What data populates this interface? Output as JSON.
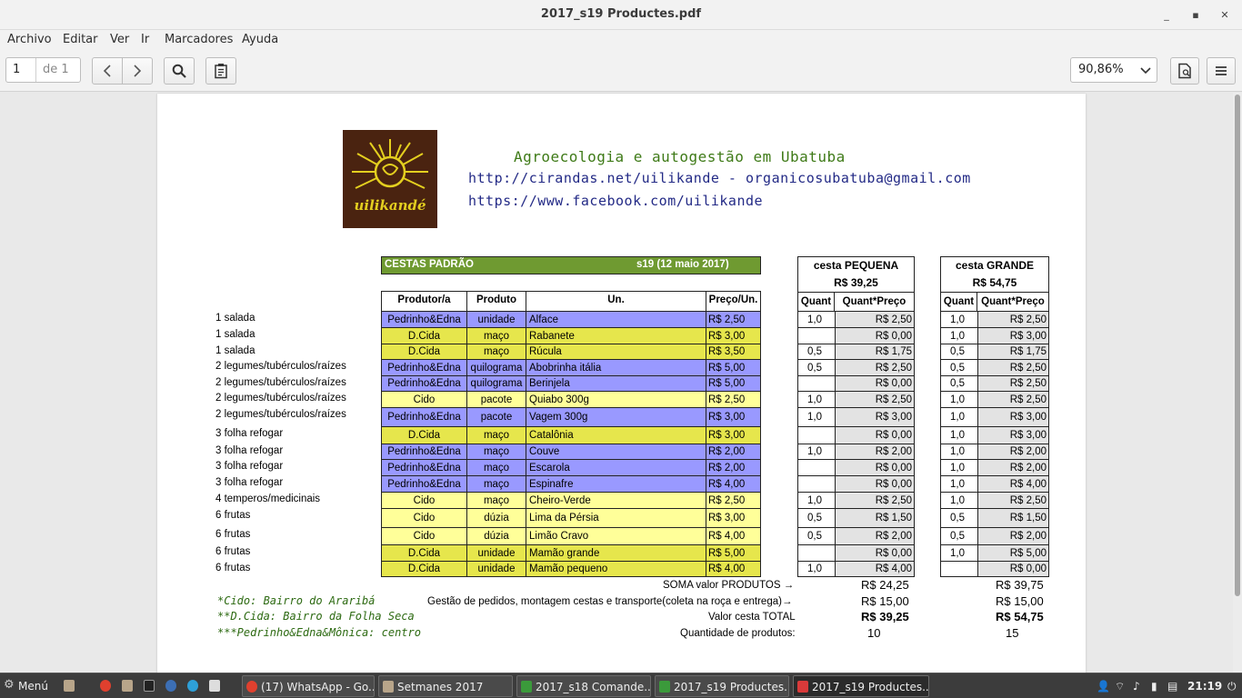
{
  "window": {
    "title": "2017_s19 Productes.pdf"
  },
  "menu": [
    "Archivo",
    "Editar",
    "Ver",
    "Ir",
    "Marcadores",
    "Ayuda"
  ],
  "toolbar": {
    "page_current": "1",
    "page_total": "de 1",
    "zoom": "90,86%"
  },
  "header": {
    "line1": "Agroecologia e autogestão em Ubatuba",
    "line2": "http://cirandas.net/uilikande  -   organicosubatuba@gmail.com",
    "line3": "https://www.facebook.com/uilikande",
    "logo_text": "uilikandé"
  },
  "table": {
    "title": "CESTAS PADRÃO",
    "week": "s19 (12 maio 2017)",
    "columns": [
      "Produtor/a",
      "Produto",
      "Un.",
      "Preço/Un."
    ],
    "small": {
      "title": "cesta PEQUENA",
      "price": "R$ 39,25",
      "cols": [
        "Quant",
        "Quant*Preço"
      ]
    },
    "large": {
      "title": "cesta GRANDE",
      "price": "R$ 54,75",
      "cols": [
        "Quant",
        "Quant*Preço"
      ]
    },
    "rows": [
      {
        "cat": "1 salada",
        "prod": "Pedrinho&Edna",
        "unit": "unidade",
        "item": "Alface",
        "price": "R$ 2,50",
        "q1": "1,0",
        "t1": "R$ 2,50",
        "q2": "1,0",
        "t2": "R$ 2,50",
        "color": "#9999ff"
      },
      {
        "cat": "1 salada",
        "prod": "D.Cida",
        "unit": "maço",
        "item": "Rabanete",
        "price": "R$ 3,00",
        "q1": "",
        "t1": "R$ 0,00",
        "q2": "1,0",
        "t2": "R$ 3,00",
        "color": "#e6e64c"
      },
      {
        "cat": "1 salada",
        "prod": "D.Cida",
        "unit": "maço",
        "item": "Rúcula",
        "price": "R$ 3,50",
        "q1": "0,5",
        "t1": "R$ 1,75",
        "q2": "0,5",
        "t2": "R$ 1,75",
        "color": "#e6e64c"
      },
      {
        "cat": "2 legumes/tubérculos/raízes",
        "prod": "Pedrinho&Edna",
        "unit": "quilograma",
        "item": "Abobrinha itália",
        "price": "R$ 5,00",
        "q1": "0,5",
        "t1": "R$ 2,50",
        "q2": "0,5",
        "t2": "R$ 2,50",
        "color": "#9999ff"
      },
      {
        "cat": "2 legumes/tubérculos/raízes",
        "prod": "Pedrinho&Edna",
        "unit": "quilograma",
        "item": "Berinjela",
        "price": "R$ 5,00",
        "q1": "",
        "t1": "R$ 0,00",
        "q2": "0,5",
        "t2": "R$ 2,50",
        "color": "#9999ff"
      },
      {
        "cat": "2 legumes/tubérculos/raízes",
        "prod": "Cido",
        "unit": "pacote",
        "item": "Quiabo 300g",
        "price": "R$ 2,50",
        "q1": "1,0",
        "t1": "R$ 2,50",
        "q2": "1,0",
        "t2": "R$ 2,50",
        "color": "#ffff99"
      },
      {
        "cat": "2 legumes/tubérculos/raízes",
        "prod": "Pedrinho&Edna",
        "unit": "pacote",
        "item": "Vagem 300g",
        "price": "R$ 3,00",
        "q1": "1,0",
        "t1": "R$ 3,00",
        "q2": "1,0",
        "t2": "R$ 3,00",
        "color": "#9999ff"
      },
      {
        "cat": "3 folha refogar",
        "prod": "D.Cida",
        "unit": "maço",
        "item": "Catalônia",
        "price": "R$ 3,00",
        "q1": "",
        "t1": "R$ 0,00",
        "q2": "1,0",
        "t2": "R$ 3,00",
        "color": "#e6e64c"
      },
      {
        "cat": "3 folha refogar",
        "prod": "Pedrinho&Edna",
        "unit": "maço",
        "item": "Couve",
        "price": "R$ 2,00",
        "q1": "1,0",
        "t1": "R$ 2,00",
        "q2": "1,0",
        "t2": "R$ 2,00",
        "color": "#9999ff"
      },
      {
        "cat": "3 folha refogar",
        "prod": "Pedrinho&Edna",
        "unit": "maço",
        "item": "Escarola",
        "price": "R$ 2,00",
        "q1": "",
        "t1": "R$ 0,00",
        "q2": "1,0",
        "t2": "R$ 2,00",
        "color": "#9999ff"
      },
      {
        "cat": "3 folha refogar",
        "prod": "Pedrinho&Edna",
        "unit": "maço",
        "item": "Espinafre",
        "price": "R$ 4,00",
        "q1": "",
        "t1": "R$ 0,00",
        "q2": "1,0",
        "t2": "R$ 4,00",
        "color": "#9999ff"
      },
      {
        "cat": "4 temperos/medicinais",
        "prod": "Cido",
        "unit": "maço",
        "item": "Cheiro-Verde",
        "price": "R$ 2,50",
        "q1": "1,0",
        "t1": "R$ 2,50",
        "q2": "1,0",
        "t2": "R$ 2,50",
        "color": "#ffff99"
      },
      {
        "cat": "6 frutas",
        "prod": "Cido",
        "unit": "dúzia",
        "item": "Lima da Pérsia",
        "price": "R$ 3,00",
        "q1": "0,5",
        "t1": "R$ 1,50",
        "q2": "0,5",
        "t2": "R$ 1,50",
        "color": "#ffff99"
      },
      {
        "cat": "6 frutas",
        "prod": "Cido",
        "unit": "dúzia",
        "item": "Limão Cravo",
        "price": "R$ 4,00",
        "q1": "0,5",
        "t1": "R$ 2,00",
        "q2": "0,5",
        "t2": "R$ 2,00",
        "color": "#ffff99"
      },
      {
        "cat": "6 frutas",
        "prod": "D.Cida",
        "unit": "unidade",
        "item": "Mamão grande",
        "price": "R$ 5,00",
        "q1": "",
        "t1": "R$ 0,00",
        "q2": "1,0",
        "t2": "R$ 5,00",
        "color": "#e6e64c"
      },
      {
        "cat": "6 frutas",
        "prod": "D.Cida",
        "unit": "unidade",
        "item": "Mamão pequeno",
        "price": "R$ 4,00",
        "q1": "1,0",
        "t1": "R$ 4,00",
        "q2": "",
        "t2": "R$ 0,00",
        "color": "#e6e64c"
      }
    ],
    "footer": [
      {
        "label": "SOMA valor PRODUTOS →",
        "small": "R$ 24,25",
        "large": "R$ 39,75"
      },
      {
        "label": "Gestão de pedidos, montagem cestas e transporte(coleta na roça e entrega)→",
        "small": "R$ 15,00",
        "large": "R$ 15,00"
      },
      {
        "label": "Valor cesta TOTAL",
        "small": "R$ 39,25",
        "large": "R$ 54,75"
      },
      {
        "label": "Quantidade de produtos:",
        "small": "10",
        "large": "15"
      }
    ],
    "notes": [
      "*Cido: Bairro do Araribá",
      "**D.Cida: Bairro da Folha Seca",
      "***Pedrinho&Edna&Mônica: centro"
    ]
  },
  "taskbar": {
    "menu": "Menú",
    "tasks": [
      "(17) WhatsApp - Go...",
      "Setmanes 2017",
      "2017_s18 Comande...",
      "2017_s19 Productes...",
      "2017_s19 Productes..."
    ],
    "clock": "21:19"
  }
}
